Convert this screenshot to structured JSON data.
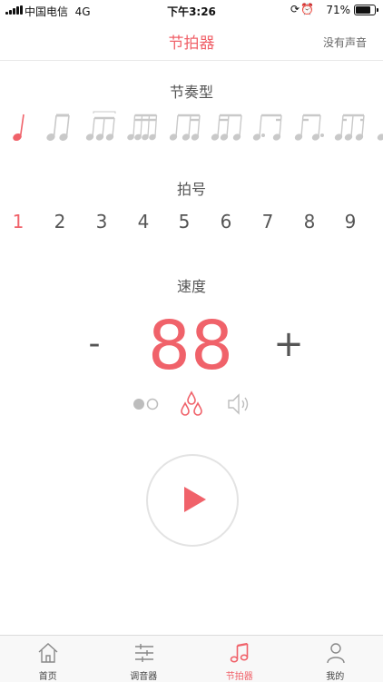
{
  "status_bar": {
    "carrier": "中国电信",
    "network": "4G",
    "time": "下午3:26",
    "battery_percent": "71%"
  },
  "nav": {
    "title": "节拍器",
    "right_label": "没有声音"
  },
  "rhythm": {
    "title": "节奏型",
    "selected_index": 0,
    "patterns": [
      "quarter",
      "two-eighths",
      "triplet",
      "four-sixteenths",
      "eighth-two-sixteenths",
      "two-sixteenths-eighth",
      "dotted-eighth-sixteenth",
      "sixteenth-dotted-eighth",
      "sixteenth-eighth-sixteenth"
    ]
  },
  "time_signature": {
    "title": "拍号",
    "selected": "1",
    "options": [
      "1",
      "2",
      "3",
      "4",
      "5",
      "6",
      "7",
      "8",
      "9"
    ]
  },
  "tempo": {
    "title": "速度",
    "value": "88",
    "minus_label": "-",
    "plus_label": "+"
  },
  "modes": [
    {
      "icon": "dots-toggle-icon",
      "active": false
    },
    {
      "icon": "water-drops-icon",
      "active": true
    },
    {
      "icon": "speaker-icon",
      "active": false
    }
  ],
  "colors": {
    "accent": "#f0626a",
    "inactive": "#cccccc",
    "text": "#555555"
  },
  "tabbar": {
    "items": [
      {
        "label": "首页",
        "icon": "home-icon"
      },
      {
        "label": "调音器",
        "icon": "sliders-icon"
      },
      {
        "label": "节拍器",
        "icon": "music-note-icon",
        "active": true
      },
      {
        "label": "我的",
        "icon": "person-icon"
      }
    ]
  }
}
